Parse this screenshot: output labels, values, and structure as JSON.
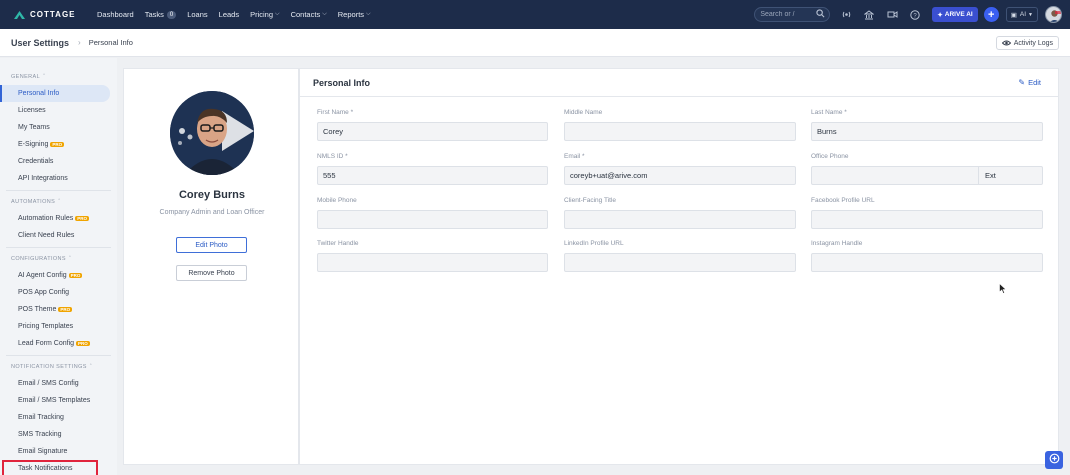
{
  "nav": {
    "brand": "COTTAGE",
    "items": [
      {
        "label": "Dashboard",
        "dropdown": false
      },
      {
        "label": "Tasks",
        "badge": "0",
        "dropdown": false
      },
      {
        "label": "Loans",
        "dropdown": false
      },
      {
        "label": "Leads",
        "dropdown": false
      },
      {
        "label": "Pricing",
        "dropdown": true
      },
      {
        "label": "Contacts",
        "dropdown": true
      },
      {
        "label": "Reports",
        "dropdown": true
      }
    ],
    "search_placeholder": "Search or /",
    "ai_button": "ARIVE AI",
    "ai_select": "AI"
  },
  "header": {
    "title": "User Settings",
    "breadcrumb": "Personal Info",
    "activity_button": "Activity Logs"
  },
  "sidebar": {
    "sections": [
      {
        "title": "GENERAL",
        "items": [
          {
            "label": "Personal Info",
            "active": true
          },
          {
            "label": "Licenses"
          },
          {
            "label": "My Teams"
          },
          {
            "label": "E-Signing",
            "pro": true
          },
          {
            "label": "Credentials"
          },
          {
            "label": "API Integrations"
          }
        ]
      },
      {
        "title": "AUTOMATIONS",
        "items": [
          {
            "label": "Automation Rules",
            "pro": true
          },
          {
            "label": "Client Need Rules"
          }
        ]
      },
      {
        "title": "CONFIGURATIONS",
        "items": [
          {
            "label": "AI Agent Config",
            "pro": true
          },
          {
            "label": "POS App Config"
          },
          {
            "label": "POS Theme",
            "pro": true
          },
          {
            "label": "Pricing Templates"
          },
          {
            "label": "Lead Form Config",
            "pro": true
          }
        ]
      },
      {
        "title": "NOTIFICATION SETTINGS",
        "items": [
          {
            "label": "Email / SMS Config"
          },
          {
            "label": "Email / SMS Templates"
          },
          {
            "label": "Email Tracking"
          },
          {
            "label": "SMS Tracking"
          },
          {
            "label": "Email Signature"
          },
          {
            "label": "Task Notifications",
            "highlight": true
          }
        ]
      }
    ],
    "pro_badge": "PRO"
  },
  "profile": {
    "name": "Corey Burns",
    "role": "Company Admin and Loan Officer",
    "edit_photo": "Edit Photo",
    "remove_photo": "Remove Photo"
  },
  "info": {
    "title": "Personal Info",
    "edit_label": "Edit",
    "fields": [
      {
        "label": "First Name *",
        "value": "Corey"
      },
      {
        "label": "Middle Name",
        "value": ""
      },
      {
        "label": "Last Name *",
        "value": "Burns"
      },
      {
        "label": "NMLS ID *",
        "value": "555"
      },
      {
        "label": "Email *",
        "value": "coreyb+uat@arive.com"
      },
      {
        "label": "Office Phone",
        "value": "",
        "ext": "Ext"
      },
      {
        "label": "Mobile Phone",
        "value": ""
      },
      {
        "label": "Client-Facing Title",
        "value": ""
      },
      {
        "label": "Facebook Profile URL",
        "value": ""
      },
      {
        "label": "Twitter Handle",
        "value": ""
      },
      {
        "label": "LinkedIn Profile URL",
        "value": ""
      },
      {
        "label": "Instagram Handle",
        "value": ""
      }
    ]
  },
  "colors": {
    "nav_bg": "#1d2c4a",
    "accent": "#3264d6",
    "ai_button": "#3a4fd0",
    "highlight_outline": "#e0243c",
    "pro_badge": "#f0a400"
  }
}
